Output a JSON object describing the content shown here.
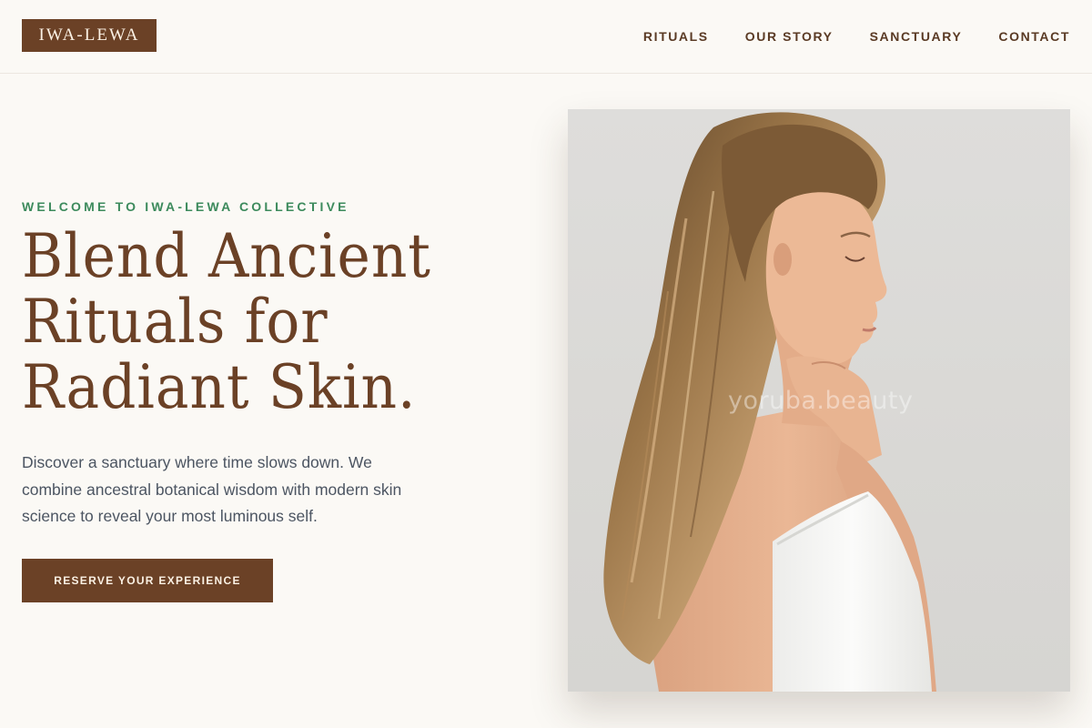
{
  "brand": {
    "logo_text": "IWA-LEWA"
  },
  "nav": {
    "items": [
      {
        "label": "RITUALS"
      },
      {
        "label": "OUR STORY"
      },
      {
        "label": "SANCTUARY"
      },
      {
        "label": "CONTACT"
      }
    ]
  },
  "hero": {
    "eyebrow": "WELCOME TO IWA-LEWA COLLECTIVE",
    "headline_lines": [
      "Blend Ancient",
      "Rituals for",
      "Radiant Skin."
    ],
    "description": "Discover a sanctuary where time slows down. We combine ancestral botanical wisdom with modern skin science to reveal your most luminous self.",
    "cta_label": "RESERVE YOUR EXPERIENCE",
    "image_watermark": "yoruba.beauty"
  },
  "colors": {
    "brand_brown": "#6b4126",
    "accent_green": "#3c8a5c",
    "background": "#fbf9f5",
    "body_text": "#4c5562"
  }
}
